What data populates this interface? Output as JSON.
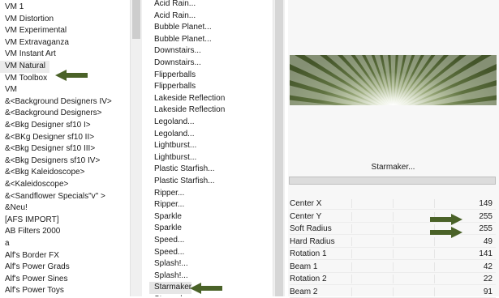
{
  "left_list": {
    "items": [
      "VM 1",
      "VM Distortion",
      "VM Experimental",
      "VM Extravaganza",
      "VM Instant Art",
      "VM Natural",
      "VM Toolbox",
      "VM",
      "&<Background Designers IV>",
      "&<Background Designers>",
      "&<Bkg Designer sf10 I>",
      "&<BKg Designer sf10 II>",
      "&<Bkg Designer sf10 III>",
      "&<Bkg Designers sf10 IV>",
      "&<Bkg Kaleidoscope>",
      "&<Kaleidoscope>",
      "&<Sandflower Specials\"v\" >",
      "&Neu!",
      "[AFS IMPORT]",
      "AB Filters 2000",
      "a",
      "Alf's Border FX",
      "Alf's Power Grads",
      "Alf's Power Sines",
      "Alf's Power Toys"
    ],
    "selected": "VM Natural"
  },
  "middle_list": {
    "items": [
      "Acid Rain...",
      "Acid Rain...",
      "Bubble Planet...",
      "Bubble Planet...",
      "Downstairs...",
      "Downstairs...",
      "Flipperballs",
      "Flipperballs",
      "Lakeside Reflection",
      "Lakeside Reflection",
      "Legoland...",
      "Legoland...",
      "Lightburst...",
      "Lightburst...",
      "Plastic Starfish...",
      "Plastic Starfish...",
      "Ripper...",
      "Ripper...",
      "Sparkle",
      "Sparkle",
      "Speed...",
      "Speed...",
      "Splash!...",
      "Splash!...",
      "Starmaker...",
      "Starmaker..."
    ],
    "selected": "Starmaker..."
  },
  "effect": {
    "name": "Starmaker..."
  },
  "params": [
    {
      "name": "Center X",
      "value": "149"
    },
    {
      "name": "Center Y",
      "value": "255"
    },
    {
      "name": "Soft Radius",
      "value": "255"
    },
    {
      "name": "Hard Radius",
      "value": "49"
    },
    {
      "name": "Rotation 1",
      "value": "141"
    },
    {
      "name": "Beam 1",
      "value": "42"
    },
    {
      "name": "Rotation 2",
      "value": "22"
    },
    {
      "name": "Beam 2",
      "value": "91"
    }
  ],
  "annotations": {
    "arrow_color": "#4a6228",
    "icon": "right-pointing-arrow-icon"
  },
  "colors": {
    "preview_dark": "#44552a",
    "preview_light": "#ffffff"
  }
}
